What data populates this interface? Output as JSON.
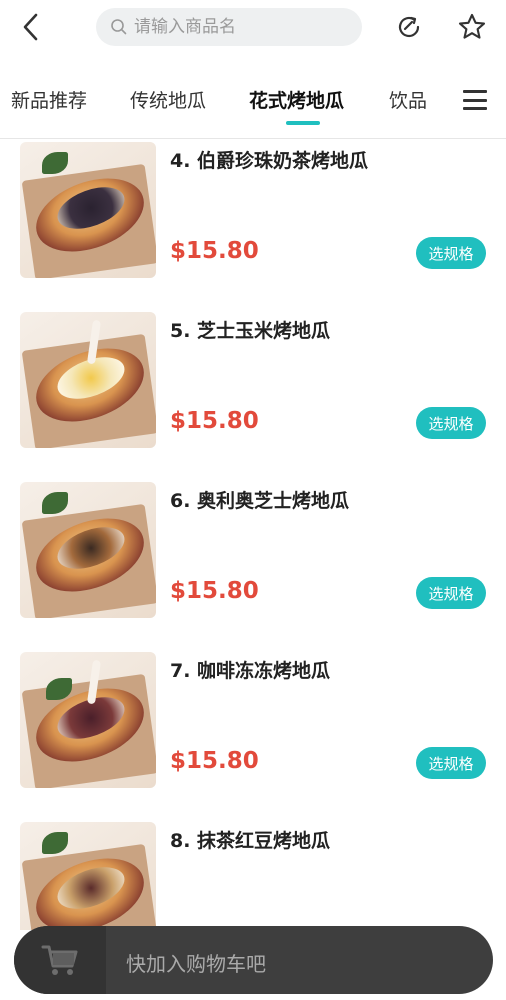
{
  "header": {
    "search_placeholder": "请输入商品名"
  },
  "tabs": [
    {
      "label": "新品推荐",
      "active": false
    },
    {
      "label": "传统地瓜",
      "active": false
    },
    {
      "label": "花式烤地瓜",
      "active": true
    },
    {
      "label": "饮品",
      "active": false
    }
  ],
  "products": [
    {
      "name": "4. 伯爵珍珠奶茶烤地瓜",
      "price": "$15.80",
      "button": "选规格"
    },
    {
      "name": "5. 芝士玉米烤地瓜",
      "price": "$15.80",
      "button": "选规格"
    },
    {
      "name": "6. 奥利奥芝士烤地瓜",
      "price": "$15.80",
      "button": "选规格"
    },
    {
      "name": "7. 咖啡冻冻烤地瓜",
      "price": "$15.80",
      "button": "选规格"
    },
    {
      "name": "8. 抹茶红豆烤地瓜"
    }
  ],
  "cart": {
    "text": "快加入购物车吧"
  },
  "colors": {
    "accent": "#20bfbf",
    "price": "#e24a3b",
    "cart_bar": "#3e3e3e"
  }
}
